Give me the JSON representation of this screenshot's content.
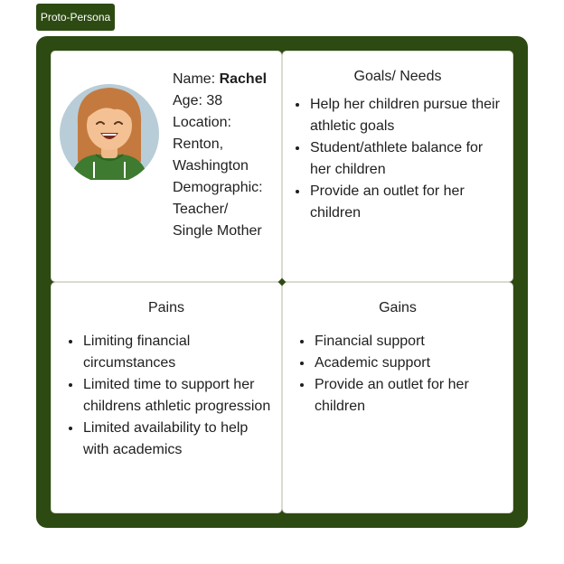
{
  "tag": {
    "label": "Proto-Persona"
  },
  "colors": {
    "frame": "#2d4a12",
    "card": "#ffffff"
  },
  "profile": {
    "avatar_icon": "woman-avatar-icon",
    "name_label": "Name: ",
    "name_value": "Rachel",
    "age": "Age: 38",
    "location_label": "Location:",
    "location_value_1": "Renton,",
    "location_value_2": "Washington",
    "demographic_label": "Demographic:",
    "demographic_value_1": "Teacher/",
    "demographic_value_2": "Single Mother"
  },
  "goals": {
    "title": "Goals/ Needs",
    "items": [
      "Help her children pursue their athletic goals",
      "Student/athlete balance for her children",
      "Provide an outlet for her children"
    ]
  },
  "pains": {
    "title": "Pains",
    "items": [
      "Limiting financial circumstances",
      "Limited time to support her childrens athletic progression",
      "Limited availability to help with academics"
    ]
  },
  "gains": {
    "title": "Gains",
    "items": [
      "Financial support",
      "Academic support",
      "Provide an outlet for her children"
    ]
  }
}
